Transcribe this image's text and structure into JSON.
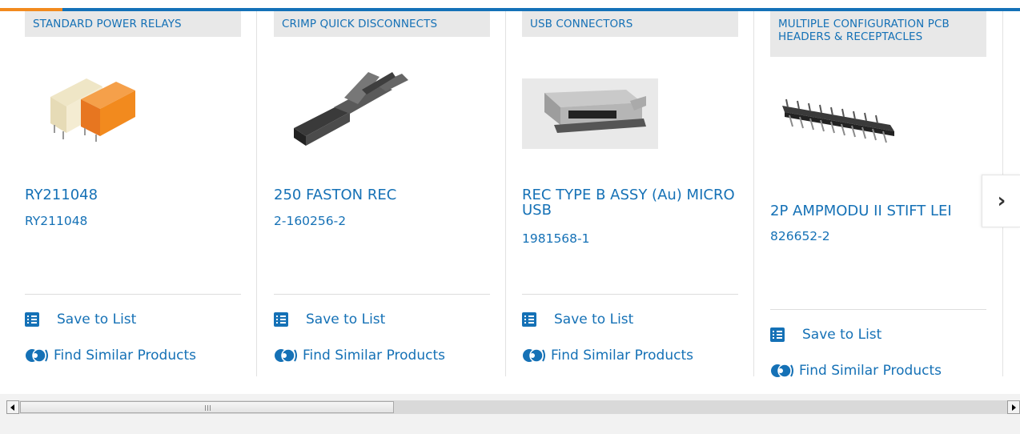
{
  "cards": [
    {
      "category": "STANDARD POWER RELAYS",
      "name": "RY211048",
      "part_number": "RY211048",
      "save_label": "Save to List",
      "similar_label": "Find Similar Products"
    },
    {
      "category": "CRIMP QUICK DISCONNECTS",
      "name": "250 FASTON REC",
      "part_number": "2-160256-2",
      "save_label": "Save to List",
      "similar_label": "Find Similar Products"
    },
    {
      "category": "USB CONNECTORS",
      "name": "REC TYPE B ASSY (Au) MICRO USB",
      "part_number": "1981568-1",
      "save_label": "Save to List",
      "similar_label": "Find Similar Products"
    },
    {
      "category": "MULTIPLE CONFIGURATION PCB HEADERS & RECEPTACLES",
      "name": "2P AMPMODU II STIFT LEI",
      "part_number": "826652-2",
      "save_label": "Save to List",
      "similar_label": "Find Similar Products"
    }
  ],
  "carousel": {
    "next_icon": "chevron-right-icon"
  },
  "colors": {
    "brand_blue": "#1571b6",
    "accent_orange": "#f28a1e",
    "category_bg": "#e8e8e8"
  }
}
